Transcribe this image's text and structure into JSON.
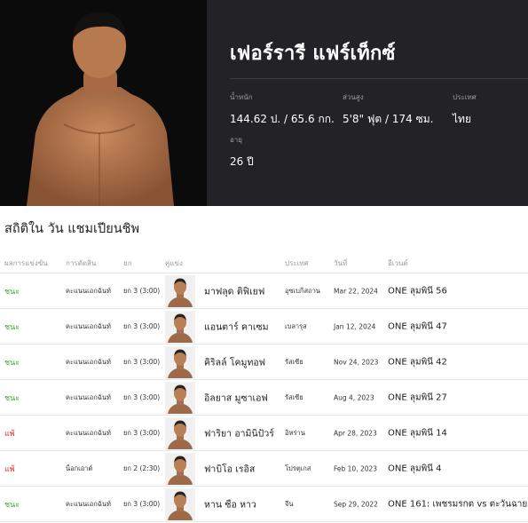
{
  "profile": {
    "name": "เฟอร์รารี แฟร์เท็กซ์",
    "stats": [
      {
        "label": "น้ำหนัก",
        "value": "144.62 ป. / 65.6 กก."
      },
      {
        "label": "ส่วนสูง",
        "value": "5'8\" ฟุต / 174 ซม."
      },
      {
        "label": "ประเทศ",
        "value": "ไทย"
      },
      {
        "label": "อายุ",
        "value": "26 ปี"
      }
    ]
  },
  "record": {
    "title": "สถิติใน วัน แชมเปียนชิพ",
    "headers": {
      "result": "ผลการแข่งขัน",
      "method": "การตัดสิน",
      "round": "ยก",
      "opponent": "คู่แข่ง",
      "country": "ประเทศ",
      "date": "วันที่",
      "event": "อีเวนต์"
    },
    "rows": [
      {
        "result": "ชนะ",
        "outcome": "win",
        "method": "คะแนนเอกฉันท์",
        "round": "ยก 3 (3:00)",
        "opponent": "มาฟลุด ติฟิเยฟ",
        "country": "อุซเบกิสถาน",
        "date": "Mar 22, 2024",
        "event": "ONE ลุมพินี 56"
      },
      {
        "result": "ชนะ",
        "outcome": "win",
        "method": "คะแนนเอกฉันท์",
        "round": "ยก 3 (3:00)",
        "opponent": "แอนตาร์ คาเซม",
        "country": "เบลารุส",
        "date": "Jan 12, 2024",
        "event": "ONE ลุมพินี 47"
      },
      {
        "result": "ชนะ",
        "outcome": "win",
        "method": "คะแนนเอกฉันท์",
        "round": "ยก 3 (3:00)",
        "opponent": "คิริลล์ โคมูทอฟ",
        "country": "รัสเซีย",
        "date": "Nov 24, 2023",
        "event": "ONE ลุมพินี 42"
      },
      {
        "result": "ชนะ",
        "outcome": "win",
        "method": "คะแนนเอกฉันท์",
        "round": "ยก 3 (3:00)",
        "opponent": "อิลยาส มูซาเอฟ",
        "country": "รัสเซีย",
        "date": "Aug 4, 2023",
        "event": "ONE ลุมพินี 27"
      },
      {
        "result": "แพ้",
        "outcome": "loss",
        "method": "คะแนนเอกฉันท์",
        "round": "ยก 3 (3:00)",
        "opponent": "ฟาริยา อามินิปัวร์",
        "country": "อิหร่าน",
        "date": "Apr 28, 2023",
        "event": "ONE ลุมพินี 14"
      },
      {
        "result": "แพ้",
        "outcome": "loss",
        "method": "น็อกเอาต์",
        "round": "ยก 2 (2:30)",
        "opponent": "ฟาบิโอ เรอิส",
        "country": "โปรตุเกส",
        "date": "Feb 10, 2023",
        "event": "ONE ลุมพินี 4"
      },
      {
        "result": "ชนะ",
        "outcome": "win",
        "method": "คะแนนเอกฉันท์",
        "round": "ยก 3 (3:00)",
        "opponent": "หาน ซือ หาว",
        "country": "จีน",
        "date": "Sep 29, 2022",
        "event": "ONE 161: เพชรมรกต vs ตะวันฉาย"
      }
    ]
  },
  "colors": {
    "win": "#3aa33a",
    "loss": "#d93232",
    "hero_bg": "#232327"
  }
}
